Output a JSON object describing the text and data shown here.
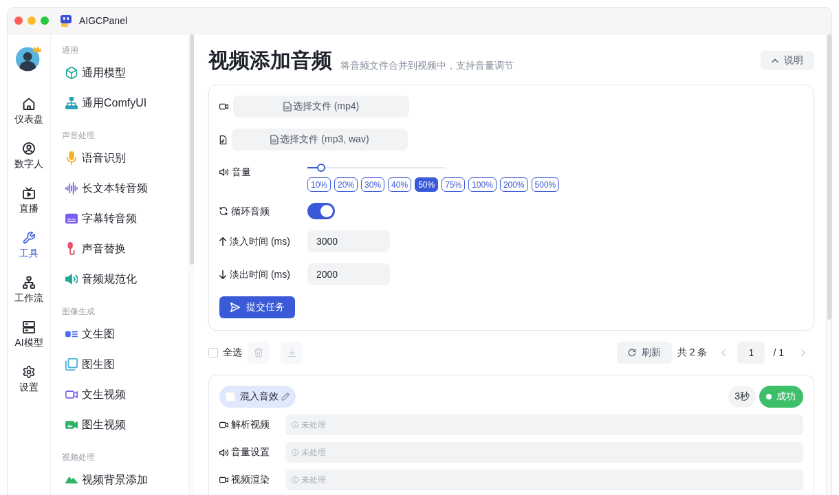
{
  "window": {
    "title": "AIGCPanel"
  },
  "rail": {
    "items": [
      {
        "label": "仪表盘",
        "selected": false
      },
      {
        "label": "数字人",
        "selected": false
      },
      {
        "label": "直播",
        "selected": false
      },
      {
        "label": "工具",
        "selected": true
      },
      {
        "label": "工作流",
        "selected": false
      },
      {
        "label": "AI模型",
        "selected": false
      },
      {
        "label": "设置",
        "selected": false
      }
    ]
  },
  "sidebar": {
    "sections": [
      {
        "heading": "通用",
        "items": [
          {
            "label": "通用模型",
            "selected": false
          },
          {
            "label": "通用ComfyUI",
            "selected": false
          }
        ]
      },
      {
        "heading": "声音处理",
        "items": [
          {
            "label": "语音识别",
            "selected": false
          },
          {
            "label": "长文本转音频",
            "selected": false
          },
          {
            "label": "字幕转音频",
            "selected": false
          },
          {
            "label": "声音替换",
            "selected": false
          },
          {
            "label": "音频规范化",
            "selected": false
          }
        ]
      },
      {
        "heading": "图像生成",
        "items": [
          {
            "label": "文生图",
            "selected": false
          },
          {
            "label": "图生图",
            "selected": false
          },
          {
            "label": "文生视频",
            "selected": false
          },
          {
            "label": "图生视频",
            "selected": false
          }
        ]
      },
      {
        "heading": "视频处理",
        "items": [
          {
            "label": "视频背景添加",
            "selected": false
          }
        ]
      }
    ]
  },
  "page": {
    "title": "视频添加音频",
    "subtitle": "将音频文件合并到视频中，支持音量调节",
    "help_button": "说明"
  },
  "form": {
    "files": [
      {
        "kind": "video",
        "button": "选择文件 (mp4)"
      },
      {
        "kind": "audio",
        "button": "选择文件 (mp3, wav)"
      }
    ],
    "volume": {
      "label": "音量",
      "level": 0.1,
      "presets": [
        {
          "label": "10%",
          "selected": false
        },
        {
          "label": "20%",
          "selected": false
        },
        {
          "label": "30%",
          "selected": false
        },
        {
          "label": "40%",
          "selected": false
        },
        {
          "label": "50%",
          "selected": true
        },
        {
          "label": "75%",
          "selected": false
        },
        {
          "label": "100%",
          "selected": false
        },
        {
          "label": "200%",
          "selected": false
        },
        {
          "label": "500%",
          "selected": false
        }
      ]
    },
    "loop": {
      "label": "循环音频",
      "on": true
    },
    "fade_in": {
      "label": "淡入时间 (ms)",
      "value": "3000"
    },
    "fade_out": {
      "label": "淡出时间 (ms)",
      "value": "2000"
    },
    "submit": "提交任务"
  },
  "toolbar": {
    "select_all": {
      "label": "全选",
      "checked": false
    },
    "delete_button": {
      "disabled": true
    },
    "download_button": {
      "disabled": true
    },
    "refresh": "刷新",
    "total": "共 2 条",
    "prev_button": {
      "disabled": true
    },
    "page": "1",
    "page_count": "/ 1",
    "next_button": {
      "disabled": true
    }
  },
  "tasks": [
    {
      "title": "混入音效",
      "checked": false,
      "duration": "3秒",
      "status": {
        "label": "成功",
        "kind": "success"
      },
      "steps": [
        {
          "kind": "video",
          "label": "解析视频",
          "result": "未处理"
        },
        {
          "kind": "audio",
          "label": "音量设置",
          "result": "未处理"
        },
        {
          "kind": "video",
          "label": "视频渲染",
          "result": "未处理"
        }
      ]
    }
  ]
}
